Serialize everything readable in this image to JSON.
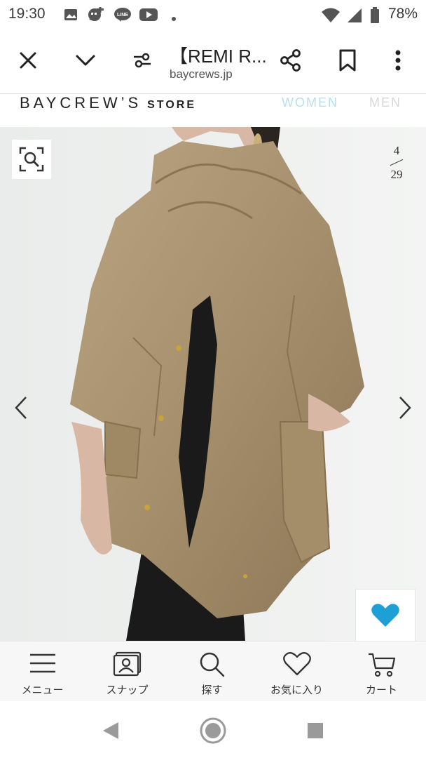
{
  "status_bar": {
    "time": "19:30",
    "battery": "78%",
    "icons": [
      "gallery-icon",
      "chat-plus-icon",
      "line-icon",
      "youtube-icon",
      "dot-icon",
      "wifi-icon",
      "signal-icon",
      "battery-icon"
    ]
  },
  "browser": {
    "title": "【REMI R...",
    "domain": "baycrews.jp",
    "icons": [
      "close-icon",
      "chevron-down-icon",
      "site-settings-icon",
      "share-icon",
      "bookmark-icon",
      "more-icon"
    ]
  },
  "site_header": {
    "logo": "BAYCREW’S",
    "logo_suffix": "STORE",
    "nav_women": "WOMEN",
    "nav_men": "MEN"
  },
  "gallery": {
    "current": "4",
    "total": "29",
    "icons": [
      "zoom-search-icon",
      "chevron-left-icon",
      "chevron-right-icon",
      "heart-icon"
    ],
    "accent": "#1ea0d6"
  },
  "tabbar": {
    "items": [
      {
        "label": "メニュー",
        "icon": "menu-icon"
      },
      {
        "label": "スナップ",
        "icon": "snap-icon"
      },
      {
        "label": "探す",
        "icon": "search-icon"
      },
      {
        "label": "お気に入り",
        "icon": "heart-outline-icon"
      },
      {
        "label": "カート",
        "icon": "cart-icon"
      }
    ]
  },
  "android_nav": {
    "icons": [
      "back-icon",
      "home-icon",
      "recents-icon"
    ]
  }
}
